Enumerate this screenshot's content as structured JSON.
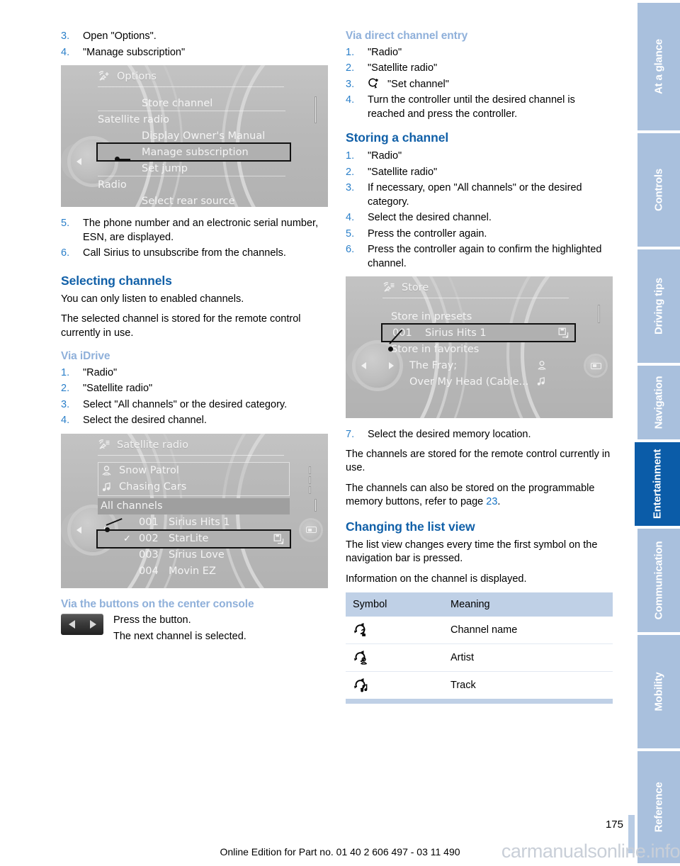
{
  "page": {
    "number": "175",
    "footer_note": "Online Edition for Part no. 01 40 2 606 497 - 03 11 490",
    "watermark": "carmanualsonline.info"
  },
  "colors": {
    "heading_dark_blue": "#1160a8",
    "heading_light_blue": "#8fb0da",
    "step_number_blue": "#2a7fc9",
    "tab_inactive": "#a9c0dd",
    "tab_active": "#0b5ca8",
    "table_header_bg": "#bfd0e6"
  },
  "left_column": {
    "steps_top": [
      {
        "num": "3.",
        "text": "Open \"Options\"."
      },
      {
        "num": "4.",
        "text": "\"Manage subscription\""
      }
    ],
    "options_screen": {
      "icon": "satellite-antenna-plus-icon",
      "title": "Options",
      "rows": [
        {
          "label": "Store channel",
          "indent": 3,
          "separator": true,
          "highlight": false
        },
        {
          "label": "Satellite radio",
          "indent": 1,
          "separator": false,
          "highlight": false
        },
        {
          "label": "Display Owner's Manual",
          "indent": 3,
          "separator": false,
          "highlight": false
        },
        {
          "label": "Manage subscription",
          "indent": 3,
          "separator": false,
          "highlight": true
        },
        {
          "label": "Set jump",
          "indent": 3,
          "separator": true,
          "highlight": false
        },
        {
          "label": "Radio",
          "indent": 1,
          "separator": false,
          "highlight": false
        },
        {
          "label": "Select rear source",
          "indent": 3,
          "separator": false,
          "highlight": false
        }
      ]
    },
    "steps_mid": [
      {
        "num": "5.",
        "text": "The phone number and an electronic serial number, ESN, are displayed."
      },
      {
        "num": "6.",
        "text": "Call Sirius to unsubscribe from the channels."
      }
    ],
    "selecting_channels": {
      "heading": "Selecting channels",
      "para1": "You can only listen to enabled channels.",
      "para2": "The selected channel is stored for the remote control currently in use."
    },
    "via_idrive": {
      "heading": "Via iDrive",
      "steps": [
        {
          "num": "1.",
          "text": "\"Radio\""
        },
        {
          "num": "2.",
          "text": "\"Satellite radio\""
        },
        {
          "num": "3.",
          "text": "Select \"All channels\" or the desired category."
        },
        {
          "num": "4.",
          "text": "Select the desired channel."
        }
      ]
    },
    "satellite_screen": {
      "icon": "satellite-antenna-list-icon",
      "title": "Satellite radio",
      "now_playing": [
        {
          "icon": "artist-icon",
          "label": "Snow Patrol"
        },
        {
          "icon": "music-note-icon",
          "label": "Chasing Cars"
        }
      ],
      "category_band": "All channels",
      "channels": [
        {
          "check": "",
          "number": "001",
          "name": "Sirius Hits 1",
          "right_icon": "",
          "highlight": false
        },
        {
          "check": "✓",
          "number": "002",
          "name": "StarLite",
          "right_icon": "save-icon",
          "highlight": true
        },
        {
          "check": "",
          "number": "003",
          "name": "Sirius Love",
          "right_icon": "",
          "highlight": false
        },
        {
          "check": "",
          "number": "004",
          "name": "Movin EZ",
          "right_icon": "",
          "highlight": false
        }
      ]
    },
    "via_buttons": {
      "heading": "Via the buttons on the center console",
      "button_icon": "seek-prev-next-button",
      "line1": "Press the button.",
      "line2": "The next channel is selected."
    }
  },
  "right_column": {
    "via_direct_entry": {
      "heading": "Via direct channel entry",
      "steps": [
        {
          "num": "1.",
          "text": "\"Radio\"",
          "icon": ""
        },
        {
          "num": "2.",
          "text": "\"Satellite radio\"",
          "icon": ""
        },
        {
          "num": "3.",
          "text": "\"Set channel\"",
          "icon": "set-channel-icon"
        },
        {
          "num": "4.",
          "text": "Turn the controller until the desired channel is reached and press the controller.",
          "icon": ""
        }
      ]
    },
    "storing_a_channel": {
      "heading": "Storing a channel",
      "steps": [
        {
          "num": "1.",
          "text": "\"Radio\""
        },
        {
          "num": "2.",
          "text": "\"Satellite radio\""
        },
        {
          "num": "3.",
          "text": "If necessary, open \"All channels\" or the desired category."
        },
        {
          "num": "4.",
          "text": "Select the desired channel."
        },
        {
          "num": "5.",
          "text": "Press the controller again."
        },
        {
          "num": "6.",
          "text": "Press the controller again to confirm the highlighted channel."
        }
      ]
    },
    "store_screen": {
      "icon": "satellite-antenna-list-icon",
      "title": "Store",
      "rows": [
        {
          "type": "label",
          "label": "Store in presets"
        },
        {
          "type": "preset",
          "number": "001",
          "name": "Sirius Hits 1",
          "right_icon": "save-icon",
          "highlight": true
        },
        {
          "type": "label",
          "label": "Store in favorites"
        },
        {
          "type": "fav",
          "name": "The Fray;",
          "right_icon": "artist-icon"
        },
        {
          "type": "fav",
          "name": "Over My Head (Cable...",
          "right_icon": "music-note-icon"
        }
      ]
    },
    "step7": {
      "num": "7.",
      "text": "Select the desired memory location."
    },
    "para_after_7a": "The channels are stored for the remote control currently in use.",
    "para_after_7b_pre": "The channels can also be stored on the programmable memory buttons, refer to page ",
    "para_after_7b_page": "23",
    "para_after_7b_post": ".",
    "changing_list_view": {
      "heading": "Changing the list view",
      "para1": "The list view changes every time the first symbol on the navigation bar is pressed.",
      "para2": "Information on the channel is displayed."
    },
    "symbol_table": {
      "headers": [
        "Symbol",
        "Meaning"
      ],
      "rows": [
        {
          "symbol": "refresh-channel-name-icon",
          "meaning": "Channel name"
        },
        {
          "symbol": "refresh-artist-icon",
          "meaning": "Artist"
        },
        {
          "symbol": "refresh-track-icon",
          "meaning": "Track"
        }
      ]
    }
  },
  "sidebar": {
    "tabs": [
      {
        "label": "At a glance",
        "active": false
      },
      {
        "label": "Controls",
        "active": false
      },
      {
        "label": "Driving tips",
        "active": false
      },
      {
        "label": "Navigation",
        "active": false
      },
      {
        "label": "Entertainment",
        "active": true
      },
      {
        "label": "Communication",
        "active": false
      },
      {
        "label": "Mobility",
        "active": false
      },
      {
        "label": "Reference",
        "active": false
      }
    ]
  }
}
